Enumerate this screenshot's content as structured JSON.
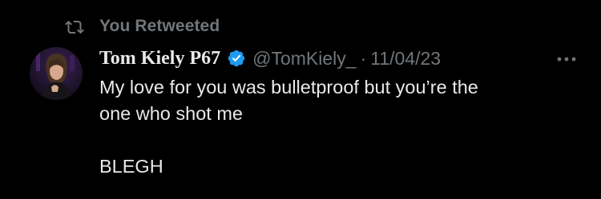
{
  "retweet": {
    "label": "You Retweeted",
    "icon": "retweet-icon"
  },
  "tweet": {
    "author_name": "Tom Kiely P67",
    "verified": true,
    "handle": "@TomKiely_",
    "separator": "·",
    "date": "11/04/23",
    "text_lines": [
      "My love for you was bulletproof but you’re the",
      "one who shot me",
      "BLEGH"
    ]
  },
  "colors": {
    "background": "#000000",
    "primary_text": "#e7e9ea",
    "secondary_text": "#71767b",
    "verified_blue": "#1d9bf0"
  },
  "icons": {
    "more": "more-horizontal-icon",
    "badge": "verified-badge-icon",
    "avatar": "avatar-photo"
  }
}
